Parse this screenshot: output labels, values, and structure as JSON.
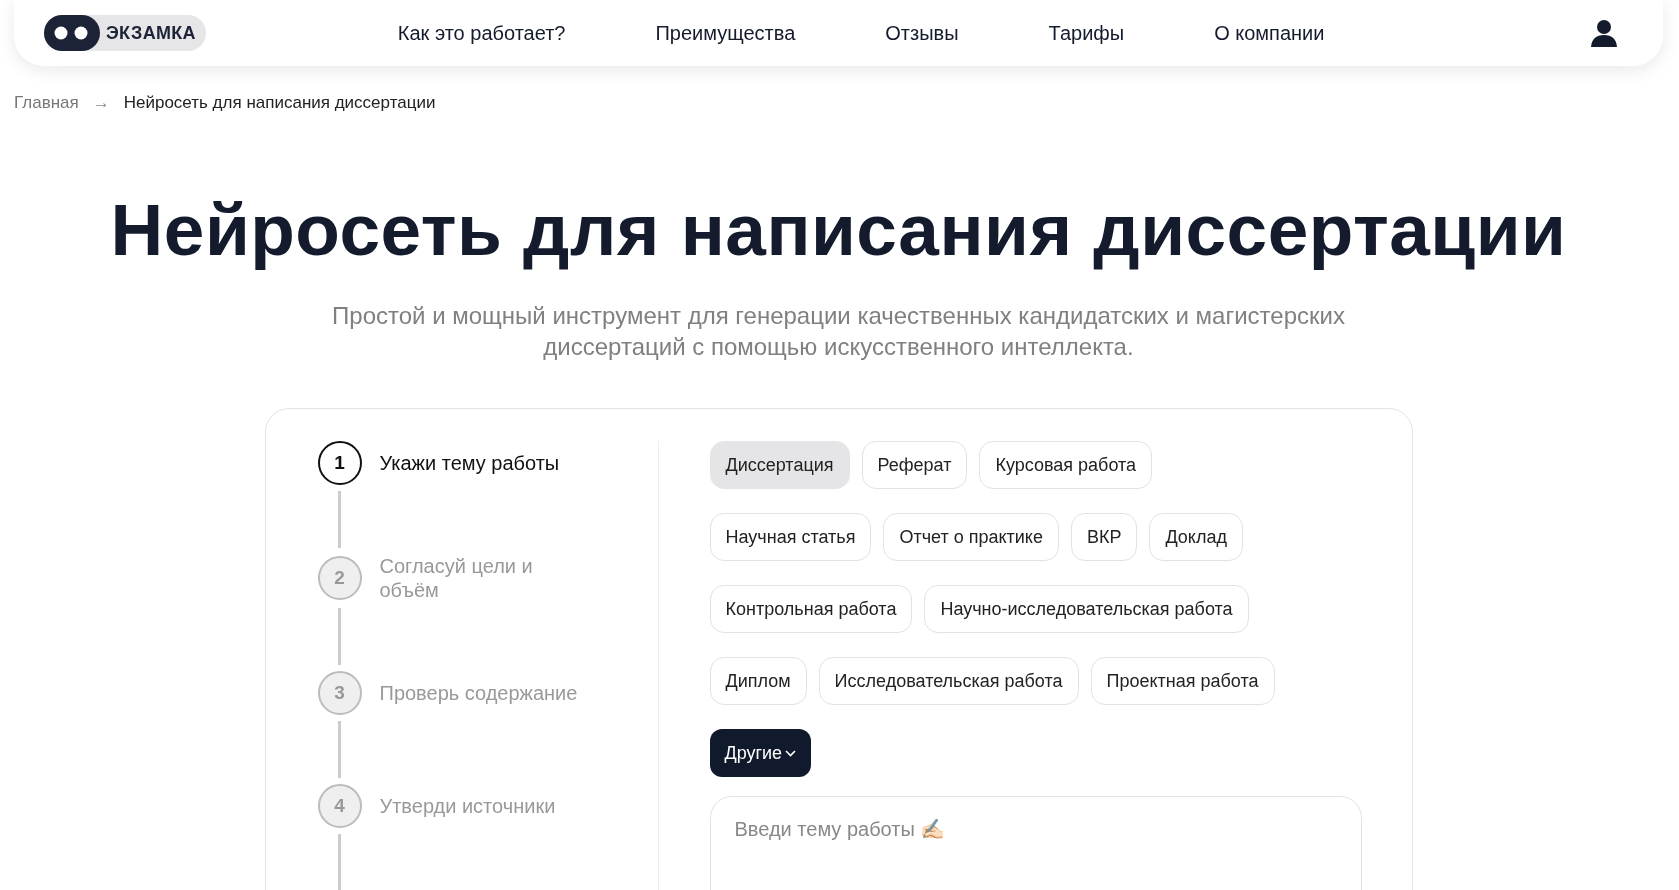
{
  "header": {
    "logo": "ЭКЗАМКА",
    "nav": [
      "Как это работает?",
      "Преимущества",
      "Отзывы",
      "Тарифы",
      "О компании"
    ]
  },
  "breadcrumbs": [
    "Главная",
    "→",
    "Нейросеть для написания диссертации"
  ],
  "title": "Нейросеть для написания диссертации",
  "subtitle": "Простой и мощный инструмент для генерации качественных кандидатских и магистерских диссертаций с помощью искусственного интеллекта.",
  "steps": [
    {
      "number": "1",
      "label": "Укажи тему работы",
      "selected": true
    },
    {
      "number": "2",
      "label": "Согласуй цели и объём",
      "selected": false
    },
    {
      "number": "3",
      "label": "Проверь содержание",
      "selected": false
    },
    {
      "number": "4",
      "label": "Утверди источники",
      "selected": false
    }
  ],
  "work_types": [
    {
      "kind": "chip",
      "label": "Диссертация",
      "selected": true
    },
    {
      "kind": "chip",
      "label": "Реферат",
      "selected": false
    },
    {
      "kind": "chip",
      "label": "Курсовая работа",
      "selected": false
    },
    {
      "kind": "break"
    },
    {
      "kind": "chip",
      "label": "Научная статья",
      "selected": false
    },
    {
      "kind": "chip",
      "label": "Отчет о практике",
      "selected": false
    },
    {
      "kind": "chip",
      "label": "ВКР",
      "selected": false
    },
    {
      "kind": "chip",
      "label": "Доклад",
      "selected": false
    },
    {
      "kind": "break"
    },
    {
      "kind": "chip",
      "label": "Контрольная работа",
      "selected": false
    },
    {
      "kind": "chip",
      "label": "Научно-исследовательская работа",
      "selected": false
    },
    {
      "kind": "break"
    },
    {
      "kind": "chip",
      "label": "Диплом",
      "selected": false
    },
    {
      "kind": "chip",
      "label": "Исследовательская работа",
      "selected": false
    },
    {
      "kind": "chip",
      "label": "Проектная работа",
      "selected": false
    },
    {
      "kind": "break"
    },
    {
      "kind": "dropdown",
      "label": "Другие"
    }
  ],
  "topic_field": {
    "placeholder": "Введи тему работы ✍🏻"
  }
}
